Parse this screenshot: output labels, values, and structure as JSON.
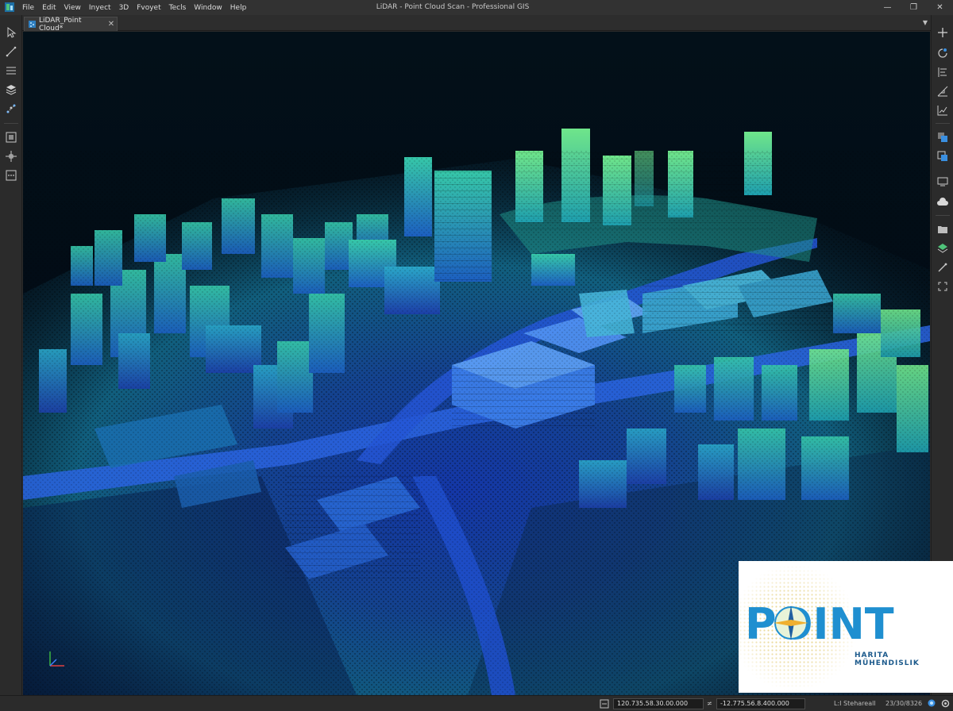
{
  "window": {
    "title": "LiDAR - Point Cloud Scan - Professional GIS",
    "controls": [
      "minimize-icon",
      "restore-icon",
      "close-icon"
    ]
  },
  "menu": [
    "File",
    "Edit",
    "View",
    "Inyect",
    "3D",
    "Fvoyet",
    "Tecls",
    "Window",
    "Help"
  ],
  "tab": {
    "label": "LiDAR_Point Cloud*",
    "close": "✕"
  },
  "left_tools": [
    "select-arrow-icon",
    "line-measure-icon",
    "list-icon",
    "layers-icon",
    "node-edit-icon",
    "zoom-extent-icon",
    "pan-move-icon",
    "options-icon"
  ],
  "right_tools": [
    "add-icon",
    "rotate-icon",
    "align-icon",
    "profile-icon",
    "chart-icon",
    "classify-icon",
    "copy-layer-icon",
    "display-icon",
    "cloud-icon",
    "folder-icon",
    "stack-icon",
    "pen-icon",
    "expand-icon"
  ],
  "logo": {
    "word": "POINT",
    "subtitle": "HARITA MÜHENDISLIK",
    "colors": {
      "text": "#1f8fd0",
      "compass": "#f0b030",
      "dots": "#e8c24a"
    }
  },
  "status": {
    "coord_x": "120.735.58.30.00.000",
    "coord_sep": "≠",
    "coord_y": "-12.775.56.8.400.000",
    "layer": "L:I Stehareall",
    "date": "23/30/8326"
  },
  "colors": {
    "ui_bg": "#2b2b2b",
    "viewport_bg": "#000b13",
    "point_low": "#1a4ad8",
    "point_mid": "#1fa8b8",
    "point_high": "#5ee07a"
  }
}
